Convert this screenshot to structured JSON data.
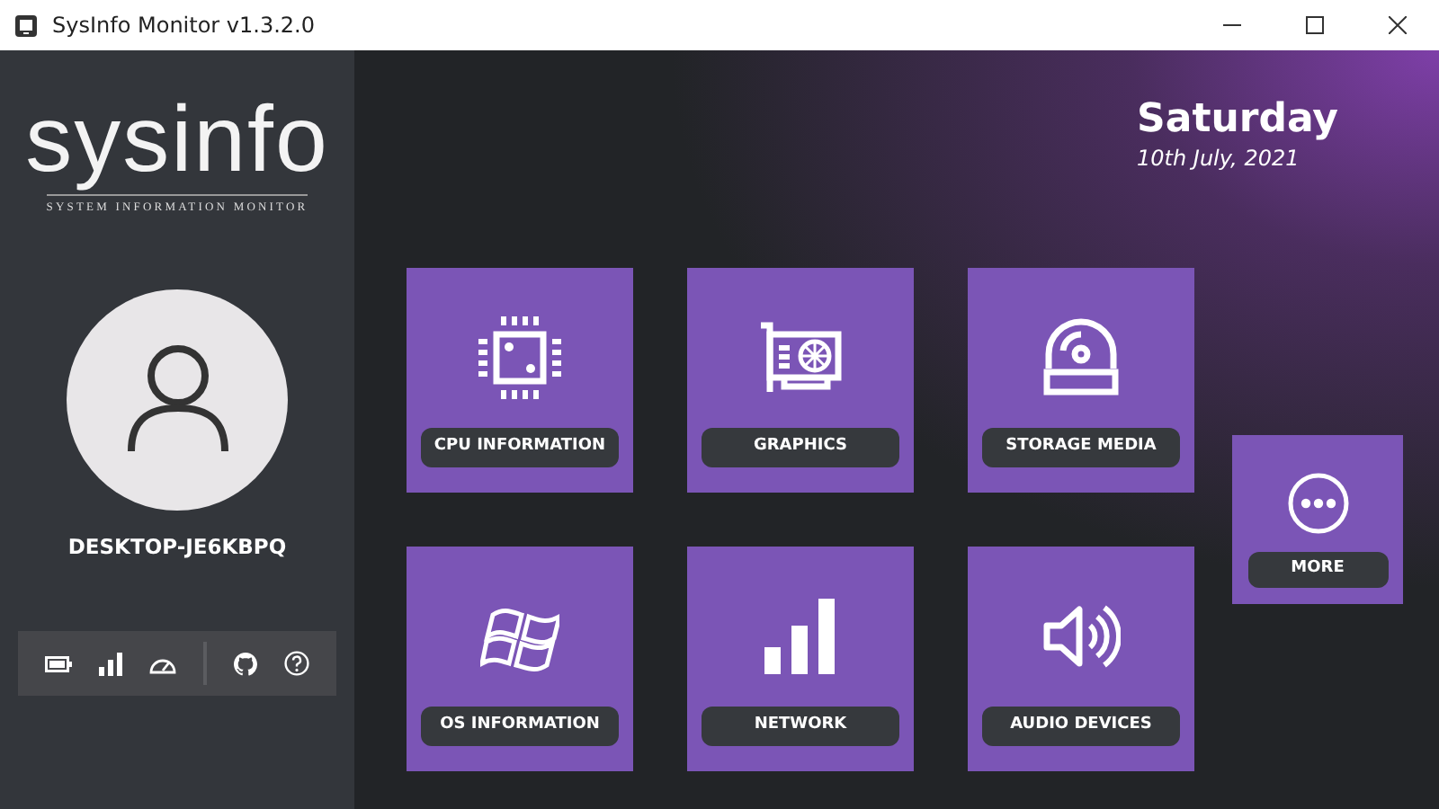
{
  "window": {
    "title": "SysInfo Monitor v1.3.2.0"
  },
  "sidebar": {
    "logo": "sysinfo",
    "tagline": "SYSTEM INFORMATION MONITOR",
    "hostname": "DESKTOP-JE6KBPQ"
  },
  "header": {
    "day": "Saturday",
    "date": "10th July, 2021"
  },
  "tiles": [
    {
      "kind": "cpu",
      "label": "CPU INFORMATION"
    },
    {
      "kind": "graphics",
      "label": "GRAPHICS"
    },
    {
      "kind": "storage",
      "label": "STORAGE MEDIA"
    },
    {
      "kind": "windows",
      "label": "OS INFORMATION"
    },
    {
      "kind": "network",
      "label": "NETWORK"
    },
    {
      "kind": "audio",
      "label": "AUDIO DEVICES"
    }
  ],
  "more_tile": {
    "label": "MORE"
  }
}
